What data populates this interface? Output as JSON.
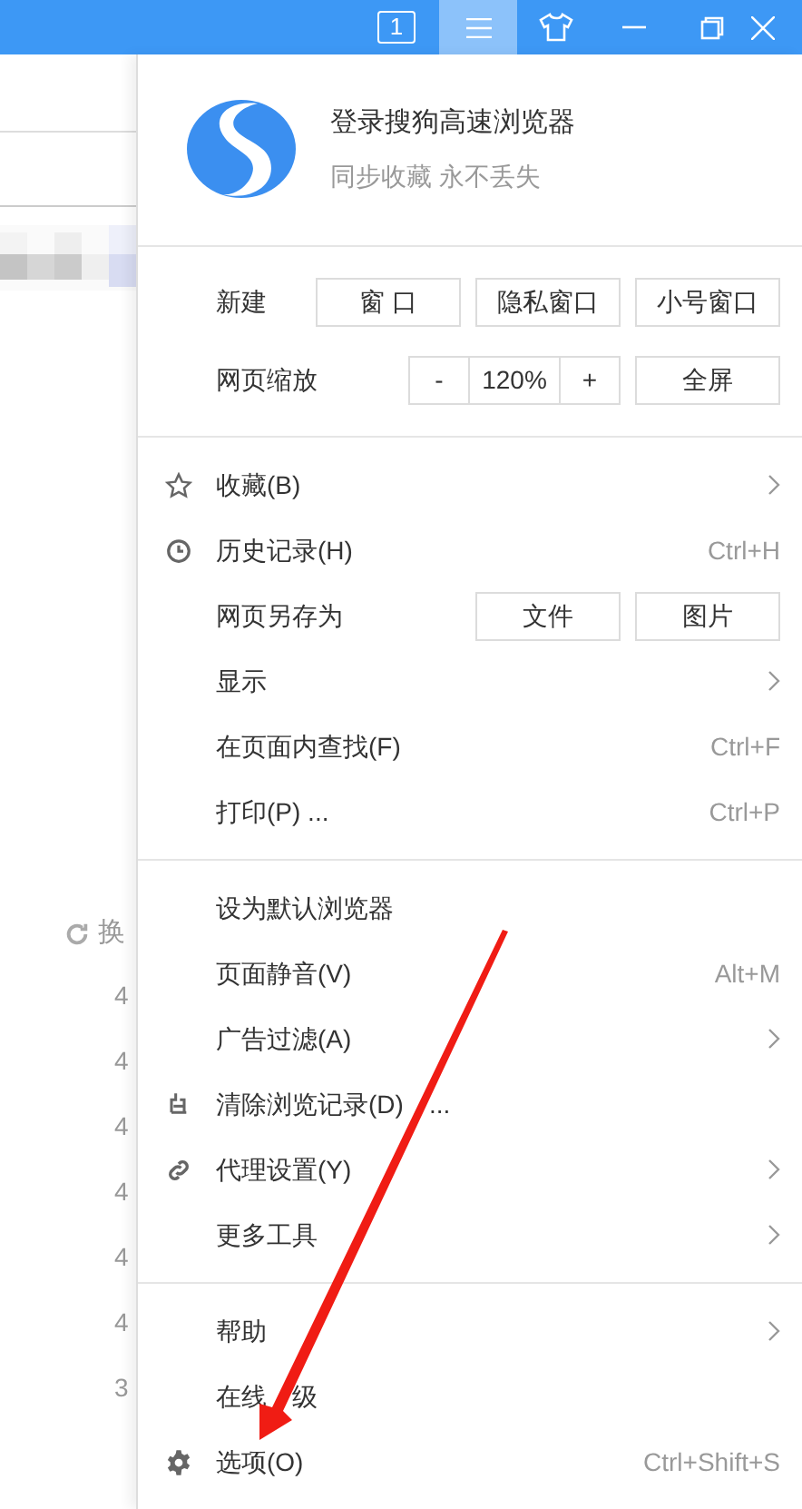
{
  "title_bar": {
    "tab_counter": "1",
    "menu_button": {
      "selected": true
    }
  },
  "background_page": {
    "refresh_label": "换",
    "numbers": [
      "4",
      "4",
      "4",
      "4",
      "4",
      "4",
      "3"
    ]
  },
  "menu": {
    "account": {
      "title": "登录搜狗高速浏览器",
      "subtitle": "同步收藏 永不丢失"
    },
    "new_row": {
      "label": "新建",
      "buttons": [
        "窗 口",
        "隐私窗口",
        "小号窗口"
      ]
    },
    "zoom_row": {
      "label": "网页缩放",
      "minus": "-",
      "value": "120%",
      "plus": "+",
      "fullscreen": "全屏"
    },
    "sections": [
      [
        {
          "kind": "submenu",
          "label": "收藏(B)"
        },
        {
          "kind": "shortcut",
          "label": "历史记录(H)",
          "shortcut": "Ctrl+H"
        },
        {
          "kind": "buttons",
          "label": "网页另存为",
          "buttons": [
            "文件",
            "图片"
          ]
        },
        {
          "kind": "submenu",
          "label": "显示"
        },
        {
          "kind": "shortcut",
          "label": "在页面内查找(F)",
          "shortcut": "Ctrl+F"
        },
        {
          "kind": "shortcut",
          "label": "打印(P) ...",
          "shortcut": "Ctrl+P"
        }
      ],
      [
        {
          "kind": "plain",
          "label": "设为默认浏览器"
        },
        {
          "kind": "shortcut",
          "label": "页面静音(V)",
          "shortcut": "Alt+M"
        },
        {
          "kind": "submenu",
          "label": "广告过滤(A)"
        },
        {
          "kind": "plain",
          "label": "清除浏览记录(D)",
          "suffix": "..."
        },
        {
          "kind": "submenu",
          "label": "代理设置(Y)"
        },
        {
          "kind": "submenu",
          "label": "更多工具"
        }
      ],
      [
        {
          "kind": "submenu",
          "label": "帮助"
        },
        {
          "kind": "plain",
          "label": "在线",
          "suffix": "级"
        },
        {
          "kind": "shortcut",
          "label": "选项(O)",
          "shortcut": "Ctrl+Shift+S"
        }
      ]
    ]
  }
}
